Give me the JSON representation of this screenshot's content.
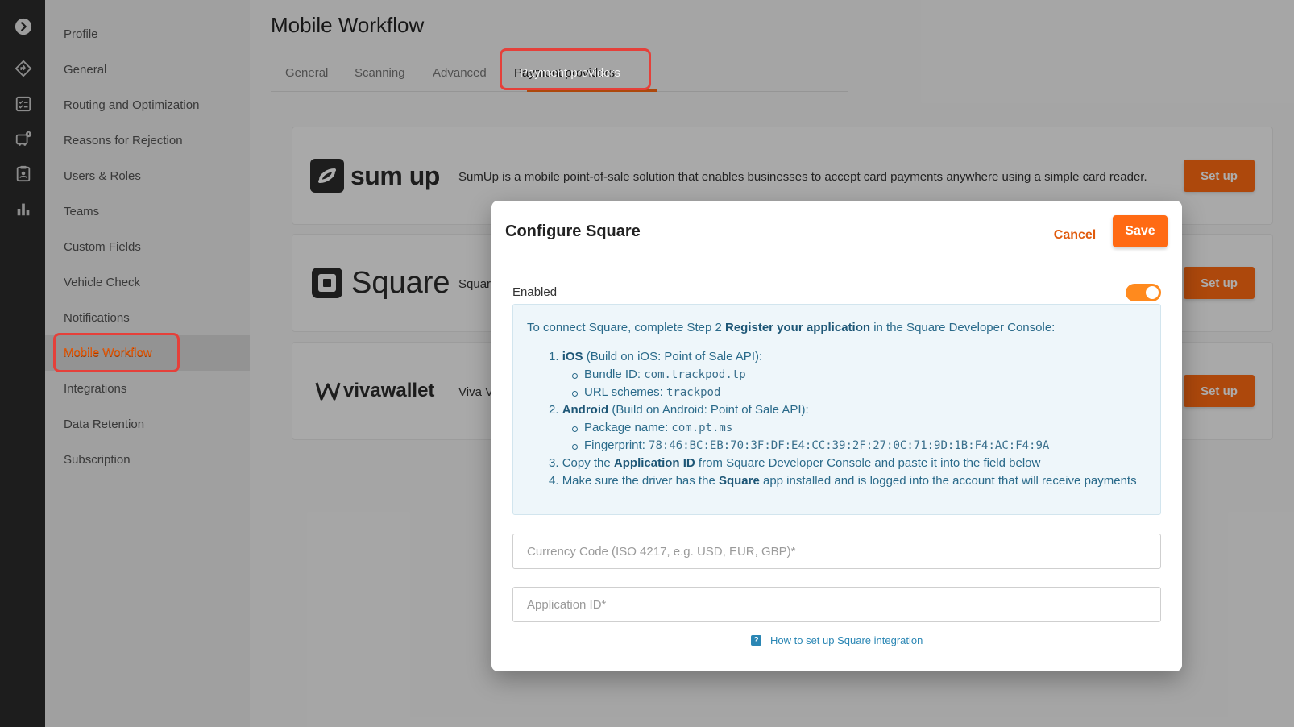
{
  "nav": {
    "items": [
      "Profile",
      "General",
      "Routing and Optimization",
      "Reasons for Rejection",
      "Users & Roles",
      "Teams",
      "Custom Fields",
      "Vehicle Check",
      "Notifications",
      "Mobile Workflow",
      "Integrations",
      "Data Retention",
      "Subscription"
    ],
    "active": "Mobile Workflow"
  },
  "rail": {
    "icons": [
      "chevron-right-icon",
      "route-icon",
      "checklist-icon",
      "vehicle-alert-icon",
      "clipboard-user-icon",
      "bar-chart-icon"
    ]
  },
  "page": {
    "title": "Mobile Workflow",
    "tabs": [
      "General",
      "Scanning",
      "Advanced",
      "Payment providers"
    ],
    "active_tab": "Payment providers"
  },
  "providers": [
    {
      "name": "sumup",
      "logo_text": "sum up",
      "description": "SumUp is a mobile point-of-sale solution that enables businesses to accept card payments anywhere using a simple card reader.",
      "button": "Set up"
    },
    {
      "name": "square",
      "logo_text": "Square",
      "description": "Squar",
      "button": "Set up"
    },
    {
      "name": "vivawallet",
      "logo_text": "vivawallet",
      "description": "Viva V",
      "button": "Set up"
    }
  ],
  "modal": {
    "title": "Configure Square",
    "cancel": "Cancel",
    "save": "Save",
    "enabled_label": "Enabled",
    "enabled": true,
    "info": {
      "intro_pre": "To connect Square, complete Step 2 ",
      "intro_bold": "Register your application",
      "intro_post": " in the Square Developer Console:",
      "step1_num": "1.",
      "step1_bold": "iOS",
      "step1_rest": " (Build on iOS: Point of Sale API):",
      "bundle_label": "Bundle ID: ",
      "bundle_value": "com.trackpod.tp",
      "url_label": "URL schemes: ",
      "url_value": "trackpod",
      "step2_num": "2.",
      "step2_bold": "Android",
      "step2_rest": " (Build on Android: Point of Sale API):",
      "package_label": "Package name: ",
      "package_value": "com.pt.ms",
      "fingerprint_label": "Fingerprint: ",
      "fingerprint_value": "78:46:BC:EB:70:3F:DF:E4:CC:39:2F:27:0C:71:9D:1B:F4:AC:F4:9A",
      "step3_num": "3.",
      "step3_pre": "Copy the ",
      "step3_bold": "Application ID",
      "step3_post": " from Square Developer Console and paste it into the field below",
      "step4_num": "4.",
      "step4_pre": "Make sure the driver has the ",
      "step4_bold": "Square",
      "step4_post": " app installed and is logged into the account that will receive payments"
    },
    "currency_placeholder": "Currency Code (ISO 4217, e.g. USD, EUR, GBP)*",
    "appid_placeholder": "Application ID*",
    "help_link": "How to set up Square integration",
    "help_icon_glyph": "?"
  },
  "colors": {
    "accent": "#ff6a13",
    "annotation": "#e5403a",
    "info_text": "#2a6a8a"
  }
}
